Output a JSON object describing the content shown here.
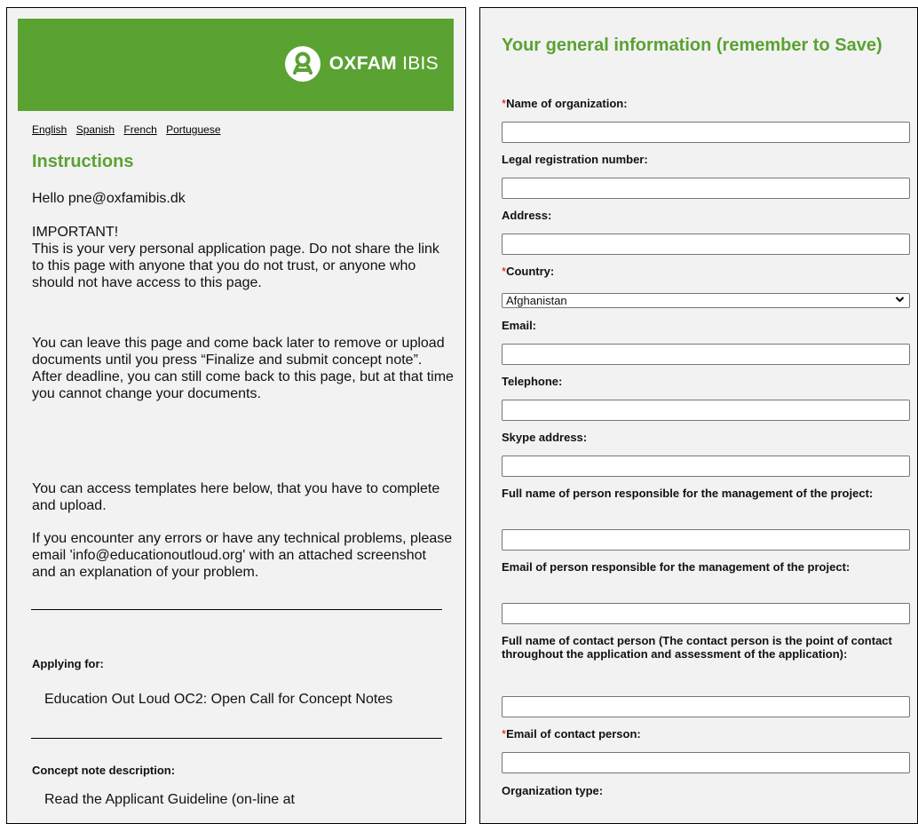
{
  "brand": {
    "name_bold": "OXFAM",
    "name_light": "IBIS",
    "banner_color": "#5aa232"
  },
  "languages": [
    "English",
    "Spanish",
    "French",
    "Portuguese"
  ],
  "instructions": {
    "heading": "Instructions",
    "greeting": "Hello pne@oxfamibis.dk",
    "important_title": "IMPORTANT!",
    "important_body": "This is your very personal application page. Do not share the link to this page with anyone that you do not trust, or anyone who should not have access to this page.",
    "para_leave": "You can leave this page and come back later to remove or upload documents until you press “Finalize and submit concept note”. After deadline, you can still come back to this page, but at that time you cannot change your documents.",
    "para_templates": "You can access templates here below, that you have to complete and upload.",
    "para_errors": "If you encounter any errors or have any technical problems, please email 'info@educationoutloud.org' with an attached screenshot and an explanation of your problem."
  },
  "applying": {
    "label": "Applying for:",
    "value": "Education Out Loud OC2: Open Call for Concept Notes"
  },
  "concept": {
    "label": "Concept note description:",
    "value": "Read the Applicant Guideline (on-line at"
  },
  "general": {
    "heading": "Your general information (remember to Save)",
    "required_mark": "*",
    "fields": {
      "org_name": "Name of organization:",
      "legal_reg": "Legal registration number:",
      "address": "Address:",
      "country": "Country:",
      "country_value": "Afghanistan",
      "email": "Email:",
      "telephone": "Telephone:",
      "skype": "Skype address:",
      "mgmt_name": "Full name of person responsible for the management of the project:",
      "mgmt_email": "Email of person responsible for the management of the project:",
      "contact_name": "Full name of contact person (The contact person is the point of contact throughout the application and assessment of the application):",
      "contact_email": "Email of contact person:",
      "org_type": "Organization type:"
    }
  }
}
